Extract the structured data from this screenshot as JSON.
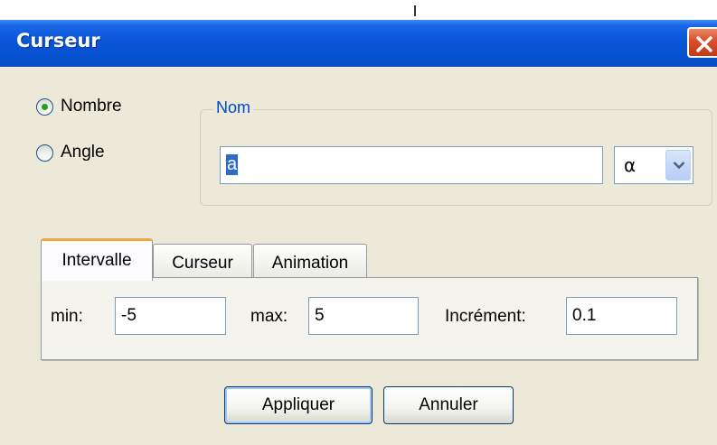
{
  "window": {
    "title": "Curseur"
  },
  "type_options": [
    {
      "label": "Nombre",
      "checked": true
    },
    {
      "label": "Angle",
      "checked": false
    }
  ],
  "name_group": {
    "legend": "Nom",
    "value": "a",
    "greek_selected": "α"
  },
  "tabs": [
    {
      "label": "Intervalle",
      "active": true
    },
    {
      "label": "Curseur",
      "active": false
    },
    {
      "label": "Animation",
      "active": false
    }
  ],
  "interval": {
    "min_label": "min:",
    "min_value": "-5",
    "max_label": "max:",
    "max_value": "5",
    "increment_label": "Incrément:",
    "increment_value": "0.1"
  },
  "buttons": {
    "apply": "Appliquer",
    "cancel": "Annuler"
  },
  "colors": {
    "titlebar": "#0a55d8",
    "dialog_bg": "#ece9d8",
    "legend_text": "#0046d5",
    "active_tab_accent": "#f0a83a",
    "close_button": "#d9532e"
  }
}
